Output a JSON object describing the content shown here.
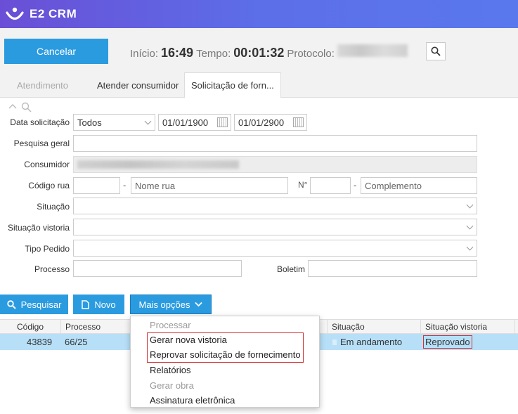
{
  "app": {
    "title": "E2 CRM"
  },
  "actionbar": {
    "cancel_label": "Cancelar",
    "inicio_label": "Início:",
    "inicio_value": "16:49",
    "tempo_label": "Tempo:",
    "tempo_value": "00:01:32",
    "protocolo_label": "Protocolo:"
  },
  "tabs": [
    {
      "label": "Atendimento"
    },
    {
      "label": "Atender consumidor"
    },
    {
      "label": "Solicitação de forn..."
    }
  ],
  "form": {
    "data_solicitacao_label": "Data solicitação",
    "data_solicitacao_select": "Todos",
    "date_from": "01/01/1900",
    "date_to": "01/01/2900",
    "pesquisa_geral_label": "Pesquisa geral",
    "consumidor_label": "Consumidor",
    "codigo_rua_label": "Código rua",
    "nome_rua_placeholder": "Nome rua",
    "numero_label": "N°",
    "complemento_placeholder": "Complemento",
    "situacao_label": "Situação",
    "situacao_vistoria_label": "Situação vistoria",
    "tipo_pedido_label": "Tipo Pedido",
    "processo_label": "Processo",
    "boletim_label": "Boletim"
  },
  "buttons": {
    "pesquisar": "Pesquisar",
    "novo": "Novo",
    "mais_opcoes": "Mais opções"
  },
  "table": {
    "headers": [
      "Código",
      "Processo",
      "Situação",
      "Situação vistoria"
    ],
    "rows": [
      {
        "codigo": "43839",
        "processo": "66/25",
        "situacao": "Em andamento",
        "situacao_vistoria": "Reprovado"
      }
    ]
  },
  "menu": {
    "items": [
      {
        "label": "Processar",
        "enabled": false
      },
      {
        "label": "Gerar nova vistoria",
        "enabled": true
      },
      {
        "label": "Reprovar solicitação de fornecimento",
        "enabled": true
      },
      {
        "label": "Relatórios",
        "enabled": true
      },
      {
        "label": "Gerar obra",
        "enabled": false
      },
      {
        "label": "Assinatura eletrônica",
        "enabled": true
      }
    ]
  },
  "colors": {
    "accent": "#2b9be0",
    "highlight_row": "#b7e0f8",
    "annotation_red": "#d23030",
    "topbar_start": "#6a4fd6",
    "topbar_end": "#5a78ee"
  }
}
